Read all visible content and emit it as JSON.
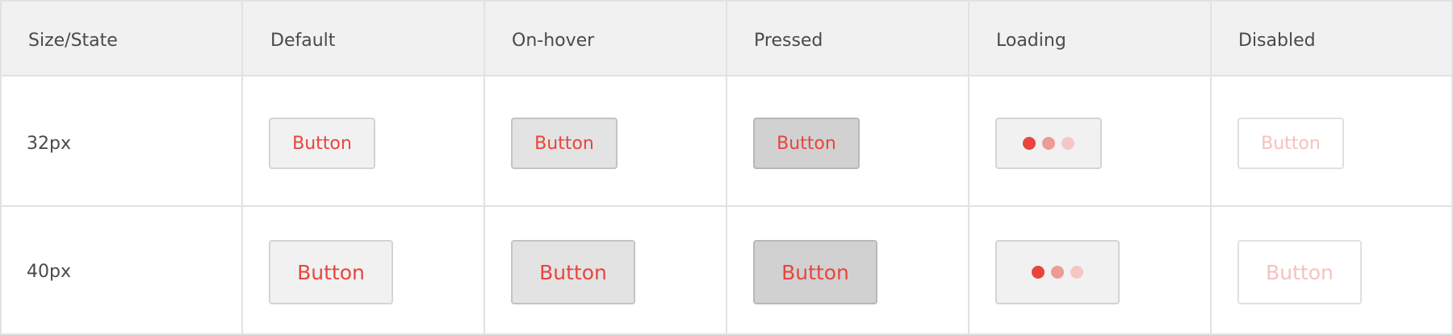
{
  "header": {
    "col0": "Size/State",
    "col1": "Default",
    "col2": "On-hover",
    "col3": "Pressed",
    "col4": "Loading",
    "col5": "Disabled"
  },
  "rows": [
    {
      "size": "32px",
      "button_label": "Button"
    },
    {
      "size": "40px",
      "button_label": "Button"
    }
  ],
  "colors": {
    "accent": "#e8453c",
    "dot_mid": "#ee9a95",
    "dot_light": "#f4c7c4",
    "disabled_text": "#f6c1bd"
  },
  "icons": {
    "loading": "loading-dots-icon"
  }
}
